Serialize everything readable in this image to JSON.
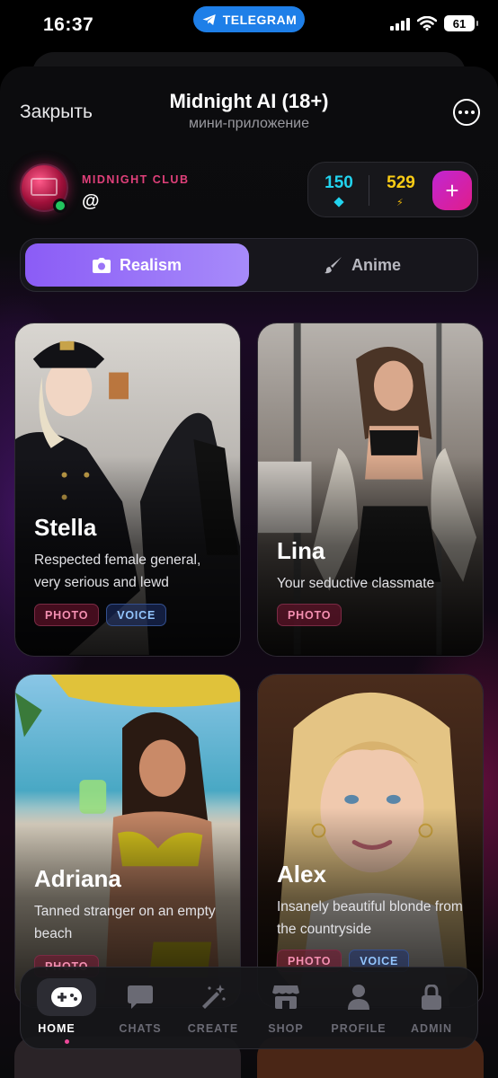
{
  "status_bar": {
    "time": "16:37",
    "telegram_label": "TELEGRAM",
    "battery": "61"
  },
  "header": {
    "close_label": "Закрыть",
    "title": "Midnight AI (18+)",
    "subtitle": "мини-приложение"
  },
  "profile": {
    "club_label": "MIDNIGHT CLUB",
    "handle": "@"
  },
  "balance": {
    "gems": "150",
    "energy": "529",
    "add_label": "+"
  },
  "mode_tabs": [
    {
      "label": "Realism",
      "icon": "camera-icon",
      "active": true
    },
    {
      "label": "Anime",
      "icon": "brush-icon",
      "active": false
    }
  ],
  "characters": [
    {
      "name": "Stella",
      "description": "Respected female general, very serious and lewd",
      "tags": [
        "PHOTO",
        "VOICE"
      ]
    },
    {
      "name": "Lina",
      "description": "Your seductive classmate",
      "tags": [
        "PHOTO"
      ]
    },
    {
      "name": "Adriana",
      "description": "Tanned stranger on an empty beach",
      "tags": [
        "PHOTO"
      ]
    },
    {
      "name": "Alex",
      "description": "Insanely beautiful blonde from the countryside",
      "tags": [
        "PHOTO",
        "VOICE"
      ]
    }
  ],
  "nav": [
    {
      "label": "HOME",
      "icon": "gamepad-icon",
      "active": true
    },
    {
      "label": "CHATS",
      "icon": "chat-icon",
      "active": false
    },
    {
      "label": "CREATE",
      "icon": "magic-wand-icon",
      "active": false
    },
    {
      "label": "SHOP",
      "icon": "store-icon",
      "active": false
    },
    {
      "label": "PROFILE",
      "icon": "user-icon",
      "active": false
    },
    {
      "label": "ADMIN",
      "icon": "lock-icon",
      "active": false
    }
  ],
  "colors": {
    "accent": "#8b5cf6",
    "pink": "#e11d8a",
    "gem": "#22d3ee",
    "energy": "#facc15",
    "online": "#22c55e"
  }
}
